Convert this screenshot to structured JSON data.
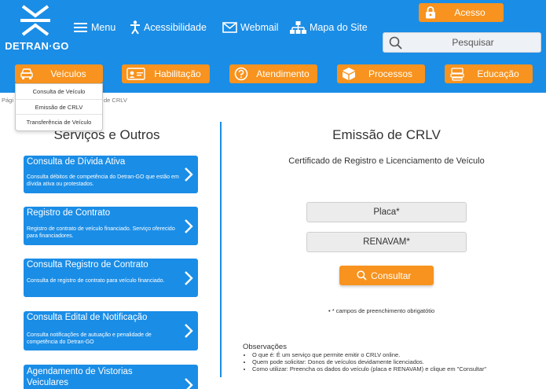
{
  "brand": {
    "name": "DETRAN·GO"
  },
  "topnav": {
    "menu": "Menu",
    "acessibilidade": "Acessibilidade",
    "webmail": "Webmail",
    "mapa": "Mapa do Site"
  },
  "acesso": {
    "label": "Acesso"
  },
  "search": {
    "placeholder": "Pesquisar"
  },
  "categories": [
    {
      "label": "Veículos",
      "icon": "car-icon"
    },
    {
      "label": "Habilitação",
      "icon": "cnh-icon"
    },
    {
      "label": "Atendimento",
      "icon": "help-icon"
    },
    {
      "label": "Processos",
      "icon": "box-icon"
    },
    {
      "label": "Educação",
      "icon": "book-icon"
    }
  ],
  "dropdown": {
    "items": [
      "Consulta de Veículo",
      "Emissão de CRLV",
      "Transferência de Veículo"
    ]
  },
  "breadcrumb": {
    "start": "Pági",
    "end": "de CRLV"
  },
  "left": {
    "title": "Serviços e Outros",
    "cards": [
      {
        "title": "Consulta de Dívida Ativa",
        "desc": "Consulta débitos de competência do Detran-GO que estão em dívida ativa ou protestados."
      },
      {
        "title": "Registro de Contrato",
        "desc": "Registro de contrato de veículo financiado. Serviço oferecido para financiadores."
      },
      {
        "title": "Consulta Registro de Contrato",
        "desc": "Consulta de registro de contrato para veículo financiado."
      },
      {
        "title": "Consulta Edital de Notificação",
        "desc": "Consulta notificações de autuação e penalidade de competência do Detran-GO"
      },
      {
        "title": "Agendamento de Vistorias Veiculares",
        "desc": ""
      }
    ]
  },
  "right": {
    "title": "Emissão de CRLV",
    "subtitle": "Certificado de Registro e Licenciamento de Veículo",
    "placa_placeholder": "Placa*",
    "renavam_placeholder": "RENAVAM*",
    "consultar_label": "Consultar",
    "required_note": "* campos de preenchimento obrigatótio",
    "obs_title": "Observações",
    "obs_items": [
      "O que é: É um serviço que permite emitir o CRLV online.",
      "Quem pode solicitar: Donos de veículos devidamente licenciados.",
      "Como utilizar: Preencha os dados do veículo (placa e RENAVAM) e clique em \"Consultar\""
    ]
  },
  "colors": {
    "primary": "#1a8de6",
    "accent": "#f7931e"
  }
}
